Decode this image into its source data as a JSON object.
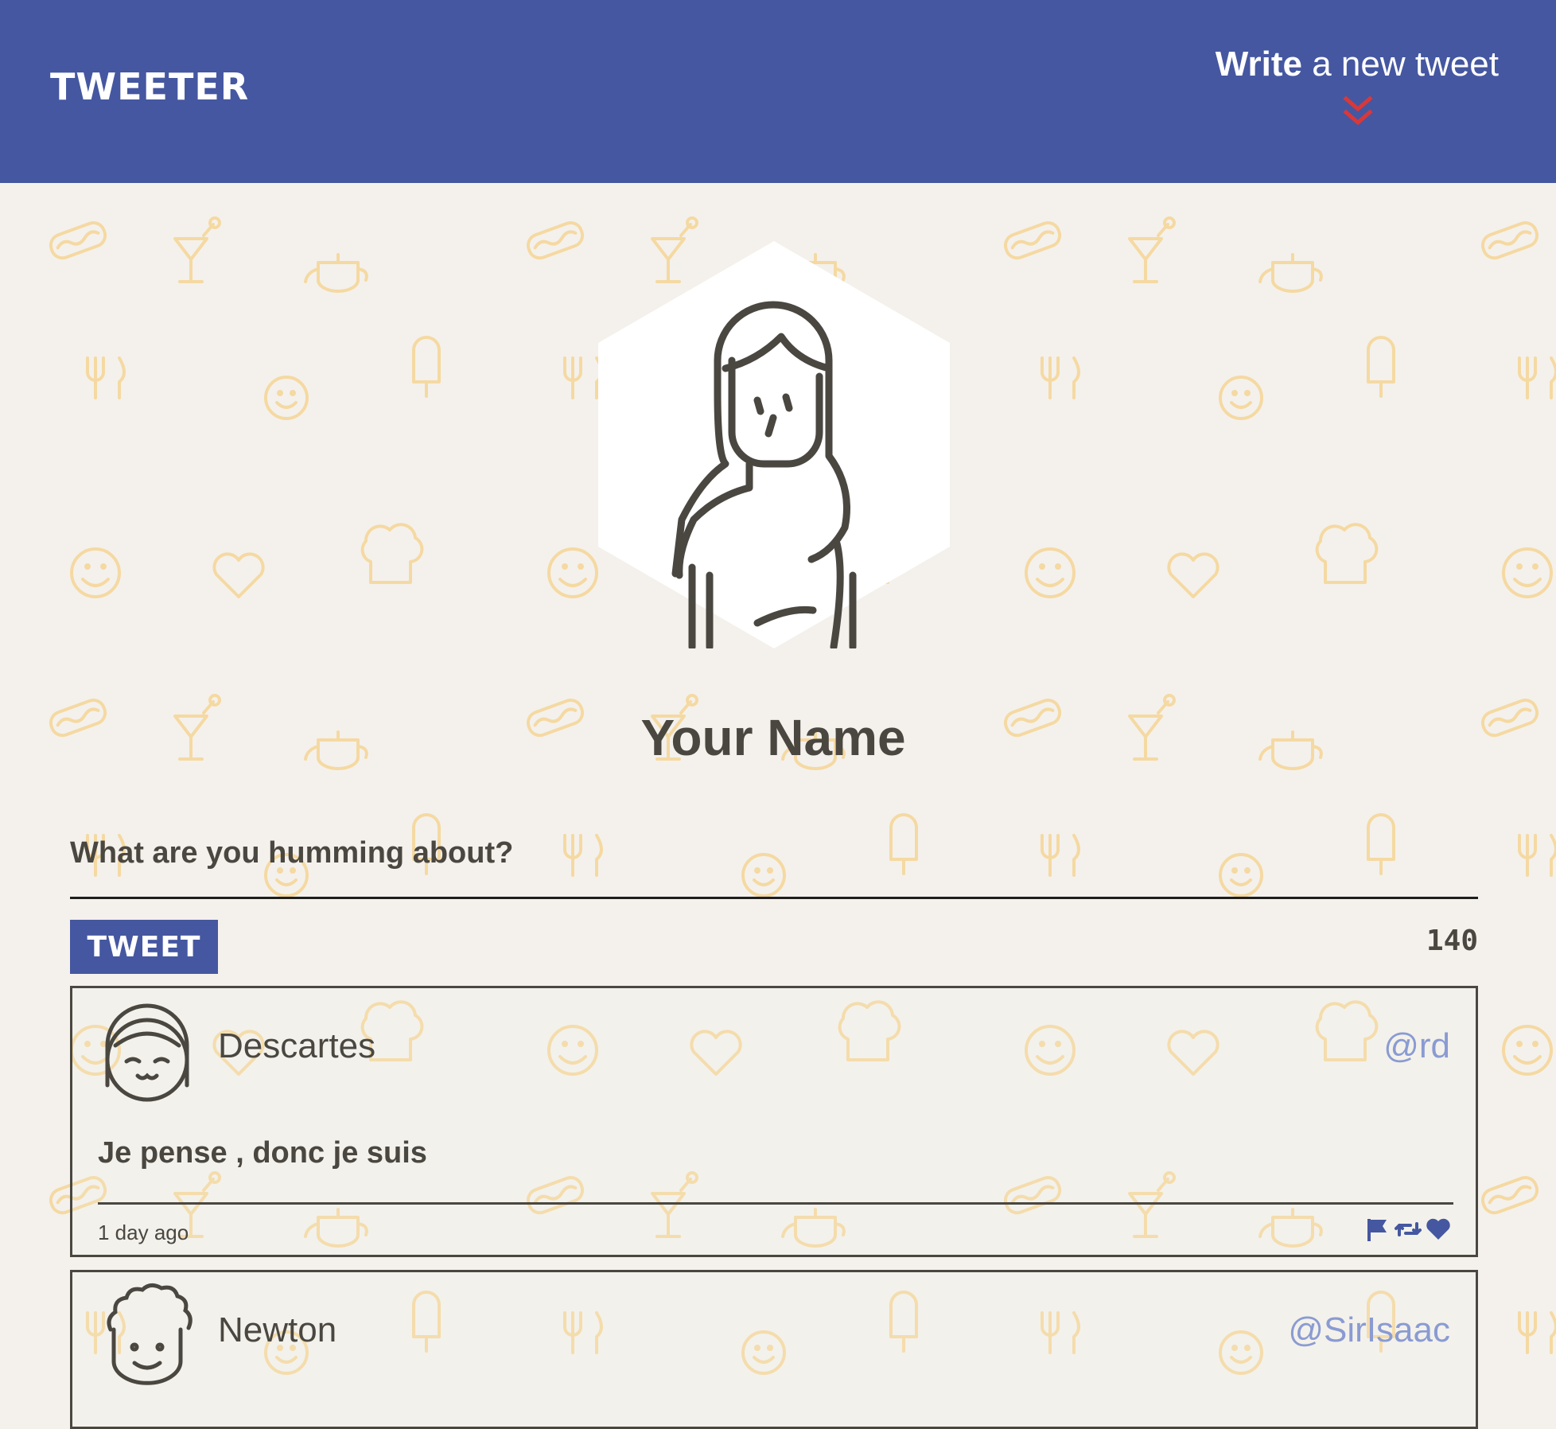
{
  "nav": {
    "brand": "TWEETER",
    "compose_bold": "Write",
    "compose_rest": " a new tweet",
    "chevron_icon": "double-chevron-down-icon"
  },
  "profile": {
    "avatar_icon": "woman-avatar-icon",
    "name": "Your Name"
  },
  "composer": {
    "placeholder": "What are you humming about?",
    "value": "",
    "submit_label": "TWEET",
    "char_counter": "140"
  },
  "tweets": [
    {
      "avatar_icon": "smiling-girl-avatar-icon",
      "name": "Descartes",
      "handle": "@rd",
      "text": "Je pense , donc je suis",
      "time": "1 day ago",
      "actions": [
        "flag-icon",
        "retweet-icon",
        "heart-icon"
      ]
    },
    {
      "avatar_icon": "curly-hair-man-avatar-icon",
      "name": "Newton",
      "handle": "@SirIsaac"
    }
  ],
  "colors": {
    "nav_bg": "#4557a0",
    "accent_red": "#d9383a",
    "page_bg": "#f4f1ec",
    "pattern": "#f5d9a2",
    "text": "#4a4741",
    "handle": "#8a9bd2"
  }
}
